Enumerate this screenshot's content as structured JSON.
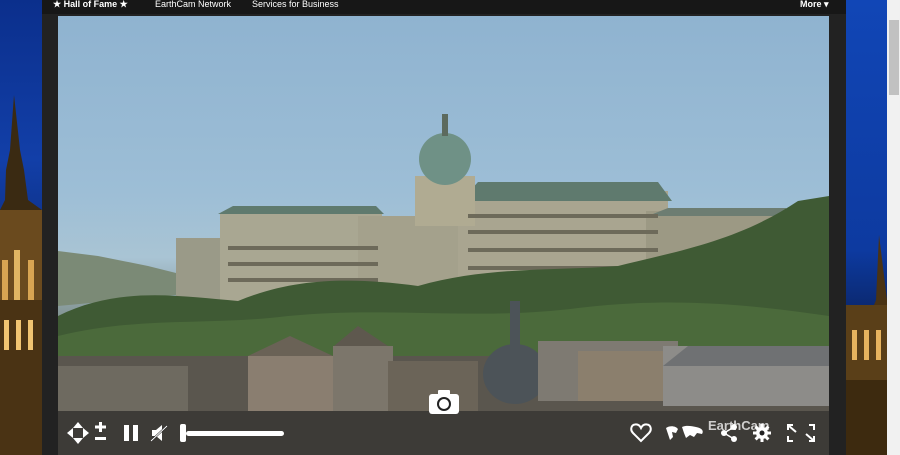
{
  "nav": {
    "hall_of_fame": "★ Hall of Fame ★",
    "network": "EarthCam Network",
    "services": "Services for Business",
    "more": "More ▾"
  },
  "player": {
    "brand": "EarthCam",
    "volume_percent": 100
  },
  "icons": [
    "move-arrows-icon",
    "zoom-in-icon",
    "zoom-out-icon",
    "pause-icon",
    "mute-icon",
    "camera-icon",
    "heart-icon",
    "world-map-icon",
    "share-icon",
    "gear-icon",
    "fullscreen-icon"
  ],
  "colors": {
    "topbar": "#171717",
    "frame": "#222222",
    "page_blue": "#0d3a9a"
  }
}
